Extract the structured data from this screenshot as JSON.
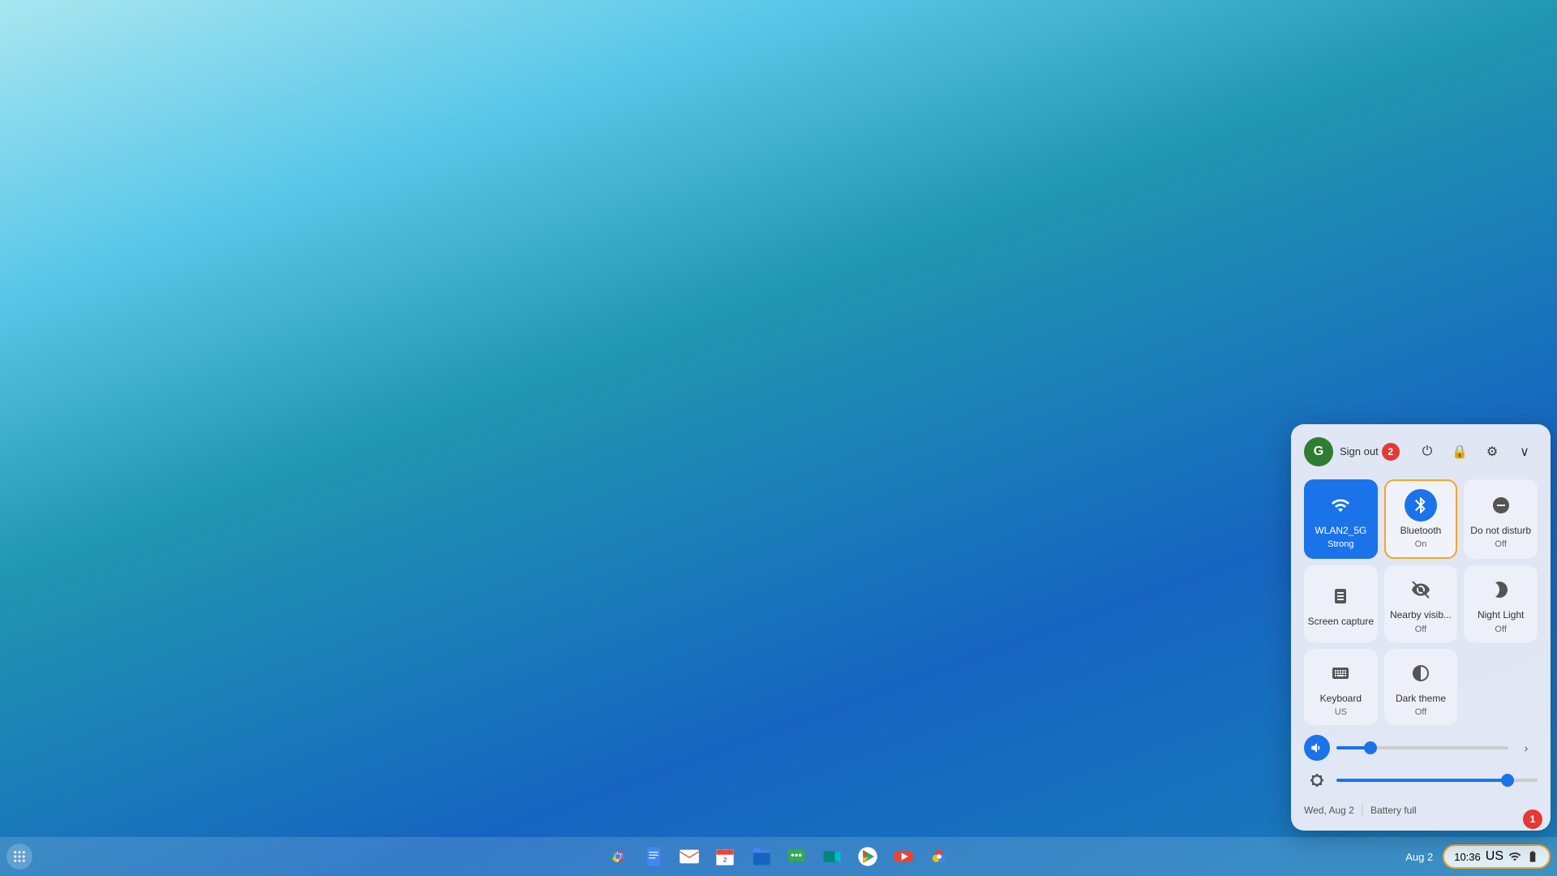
{
  "desktop": {
    "background": "blue gradient"
  },
  "taskbar": {
    "apps": [
      {
        "name": "Chrome",
        "icon": "chrome"
      },
      {
        "name": "Google Docs",
        "icon": "docs"
      },
      {
        "name": "Gmail",
        "icon": "gmail"
      },
      {
        "name": "Google Calendar",
        "icon": "calendar"
      },
      {
        "name": "Files",
        "icon": "files"
      },
      {
        "name": "Chat",
        "icon": "chat"
      },
      {
        "name": "Meet",
        "icon": "meet"
      },
      {
        "name": "Google Play",
        "icon": "play"
      },
      {
        "name": "YouTube",
        "icon": "youtube"
      },
      {
        "name": "Google Photos",
        "icon": "photos"
      }
    ],
    "system_tray": {
      "time": "10:36",
      "region": "US",
      "date": "Aug 2"
    }
  },
  "quick_settings": {
    "user": {
      "initial": "G",
      "sign_out_label": "Sign out",
      "notification_count": "2"
    },
    "header_icons": {
      "power": "⏻",
      "lock": "🔒",
      "settings": "⚙",
      "collapse": "∨"
    },
    "tiles": [
      {
        "id": "wifi",
        "label": "WLAN2_5G",
        "sub": "Strong",
        "status": "active",
        "has_arrow": true
      },
      {
        "id": "bluetooth",
        "label": "Bluetooth",
        "sub": "On",
        "status": "selected",
        "has_arrow": true
      },
      {
        "id": "do-not-disturb",
        "label": "Do not disturb",
        "sub": "Off",
        "status": "inactive"
      },
      {
        "id": "screen-capture",
        "label": "Screen capture",
        "sub": "",
        "status": "inactive"
      },
      {
        "id": "nearby-share",
        "label": "Nearby visib...",
        "sub": "Off",
        "status": "inactive"
      },
      {
        "id": "night-light",
        "label": "Night Light",
        "sub": "Off",
        "status": "inactive"
      },
      {
        "id": "keyboard",
        "label": "Keyboard",
        "sub": "US",
        "status": "inactive",
        "has_arrow": true
      },
      {
        "id": "dark-theme",
        "label": "Dark theme",
        "sub": "Off",
        "status": "inactive"
      }
    ],
    "sliders": [
      {
        "id": "volume",
        "value": 20,
        "has_arrow": true
      },
      {
        "id": "brightness",
        "value": 85,
        "has_arrow": false
      }
    ],
    "footer": {
      "date": "Wed, Aug 2",
      "battery": "Battery full"
    }
  },
  "notification_badge_1": "1",
  "notification_badge_2": "2"
}
